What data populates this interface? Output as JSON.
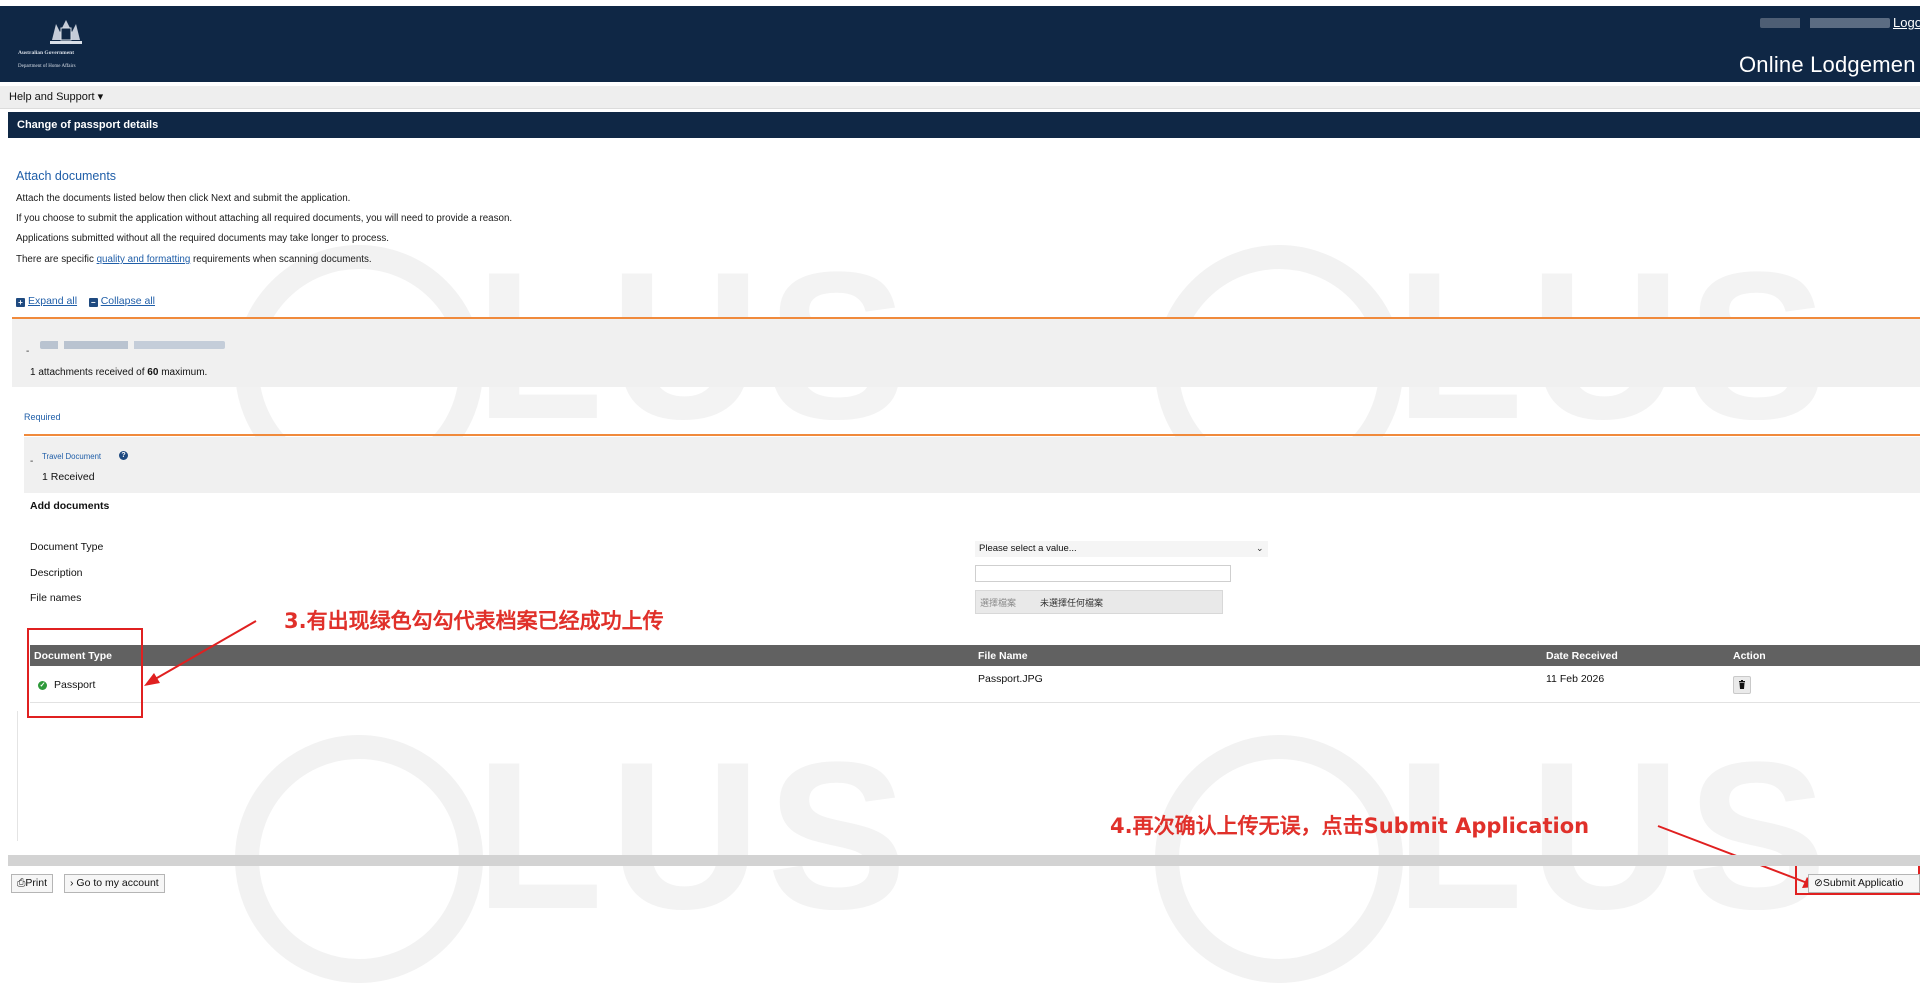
{
  "header": {
    "gov_name": "Australian Government",
    "dept_name": "Department of Home Affairs",
    "logout": "Logo",
    "portal_title": "Online Lodgemen"
  },
  "menu": {
    "help": "Help and Support ▾"
  },
  "page_title": "Change of passport details",
  "attach": {
    "heading": "Attach documents",
    "line1": "Attach the documents listed below then click Next and submit the application.",
    "line2": "If you choose to submit the application without attaching all required documents, you will need to provide a reason.",
    "line3": "Applications submitted without all the required documents may take longer to process.",
    "line4_pre": "There are specific ",
    "line4_link": "quality and formatting",
    "line4_post": " requirements when scanning documents.",
    "expand_all": "Expand all",
    "collapse_all": "Collapse all"
  },
  "applicant": {
    "attach_count_pre": "1 attachments received of ",
    "attach_count_max": "60",
    "attach_count_post": " maximum."
  },
  "required_label": "Required",
  "travel_doc": {
    "title": "Travel Document",
    "received": "1 Received"
  },
  "add_documents": {
    "heading": "Add documents",
    "doc_type_label": "Document Type",
    "description_label": "Description",
    "file_names_label": "File names",
    "doc_type_selected": "Please select a value...",
    "description_value": "",
    "choose_file": "選擇檔案",
    "no_file": "未選擇任何檔案"
  },
  "table": {
    "headers": [
      "Document Type",
      "File Name",
      "Date Received",
      "Action"
    ],
    "rows": [
      {
        "doc_type": "Passport",
        "file_name": "Passport.JPG",
        "date": "11 Feb 2026"
      }
    ]
  },
  "annotations": {
    "step3": "3.有出现绿色勾勾代表档案已经成功上传",
    "step4": "4.再次确认上传无误，点击Submit Application"
  },
  "footer": {
    "print": "Print",
    "my_account": "Go to my account",
    "submit": "Submit Applicatio"
  },
  "watermark": "LUS",
  "colors": {
    "header_navy": "#0f2745",
    "accent_orange": "#f08a3c",
    "link_blue": "#1f5ea8",
    "annotation_red": "#e0302a",
    "success_green": "#2e9a3a"
  }
}
